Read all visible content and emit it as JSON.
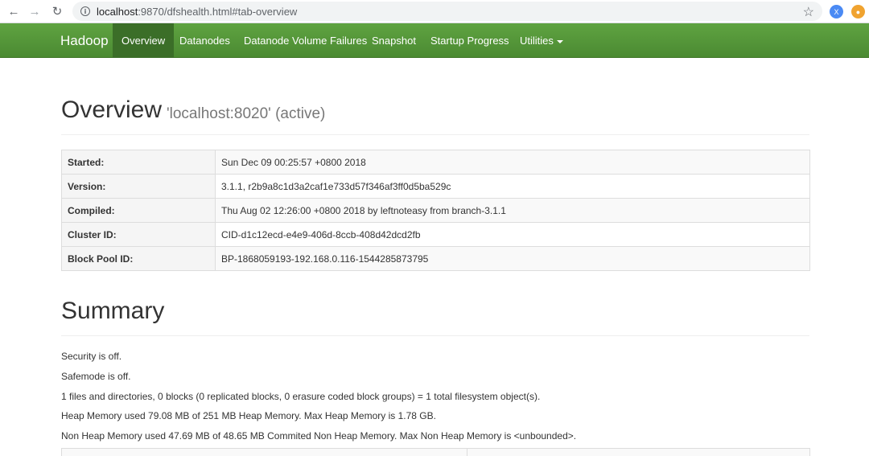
{
  "browser": {
    "url_host": "localhost",
    "url_path": ":9870/dfshealth.html#tab-overview",
    "ext_x_label": "X"
  },
  "navbar": {
    "brand": "Hadoop",
    "items": [
      {
        "label": "Overview",
        "active": true
      },
      {
        "label": "Datanodes"
      },
      {
        "label": "Datanode Volume Failures"
      },
      {
        "label": "Snapshot"
      },
      {
        "label": "Startup Progress"
      },
      {
        "label": "Utilities"
      }
    ]
  },
  "overview": {
    "title": "Overview",
    "subtitle": "'localhost:8020' (active)",
    "rows": [
      {
        "key": "Started:",
        "value": "Sun Dec 09 00:25:57 +0800 2018"
      },
      {
        "key": "Version:",
        "value": "3.1.1, r2b9a8c1d3a2caf1e733d57f346af3ff0d5ba529c"
      },
      {
        "key": "Compiled:",
        "value": "Thu Aug 02 12:26:00 +0800 2018 by leftnoteasy from branch-3.1.1"
      },
      {
        "key": "Cluster ID:",
        "value": "CID-d1c12ecd-e4e9-406d-8ccb-408d42dcd2fb"
      },
      {
        "key": "Block Pool ID:",
        "value": "BP-1868059193-192.168.0.116-1544285873795"
      }
    ]
  },
  "summary": {
    "title": "Summary",
    "lines": [
      "Security is off.",
      "Safemode is off.",
      "1 files and directories, 0 blocks (0 replicated blocks, 0 erasure coded block groups) = 1 total filesystem object(s).",
      "Heap Memory used 79.08 MB of 251 MB Heap Memory. Max Heap Memory is 1.78 GB.",
      "Non Heap Memory used 47.69 MB of 48.65 MB Commited Non Heap Memory. Max Non Heap Memory is <unbounded>."
    ]
  }
}
